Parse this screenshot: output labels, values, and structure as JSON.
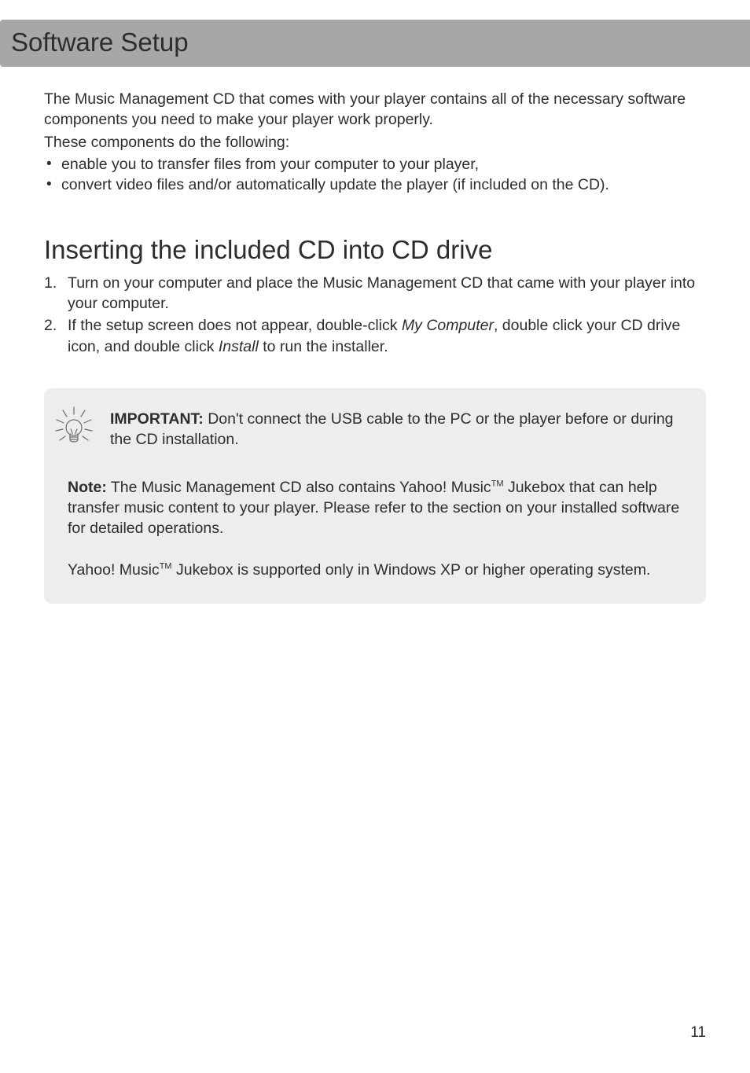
{
  "header": {
    "title": "Software Setup"
  },
  "intro": {
    "p1": "The Music Management CD that comes with your player contains all of the necessary software components you need to make your player work properly.",
    "p2": "These components do the following:",
    "bullets": [
      "enable you to transfer files from your computer to your player,",
      "convert video files and/or automatically update the player (if included on the CD)."
    ]
  },
  "section": {
    "heading": "Inserting the included CD into CD drive",
    "steps": {
      "s1": "Turn on your computer and place the Music Management CD that came with your player into your computer.",
      "s2_pre": "If the setup screen does not appear, double-click ",
      "s2_em1": "My Computer",
      "s2_mid": ", double click your CD drive icon, and double click ",
      "s2_em2": "Install ",
      "s2_post": "to run the installer."
    }
  },
  "infobox": {
    "important_label": "IMPORTANT:",
    "important_text": " Don't connect the USB cable to the PC or the player before or during the CD installation.",
    "note_label": "Note:",
    "note_text_a": " The Music Management CD also contains Yahoo! Music",
    "tm": "TM",
    "note_text_b": " Jukebox that can help transfer music content to your player. Please refer to the section on your installed software for detailed operations.",
    "support_a": "Yahoo! Music",
    "support_b": " Jukebox is supported only in Windows XP or higher operating system."
  },
  "page_number": "11"
}
